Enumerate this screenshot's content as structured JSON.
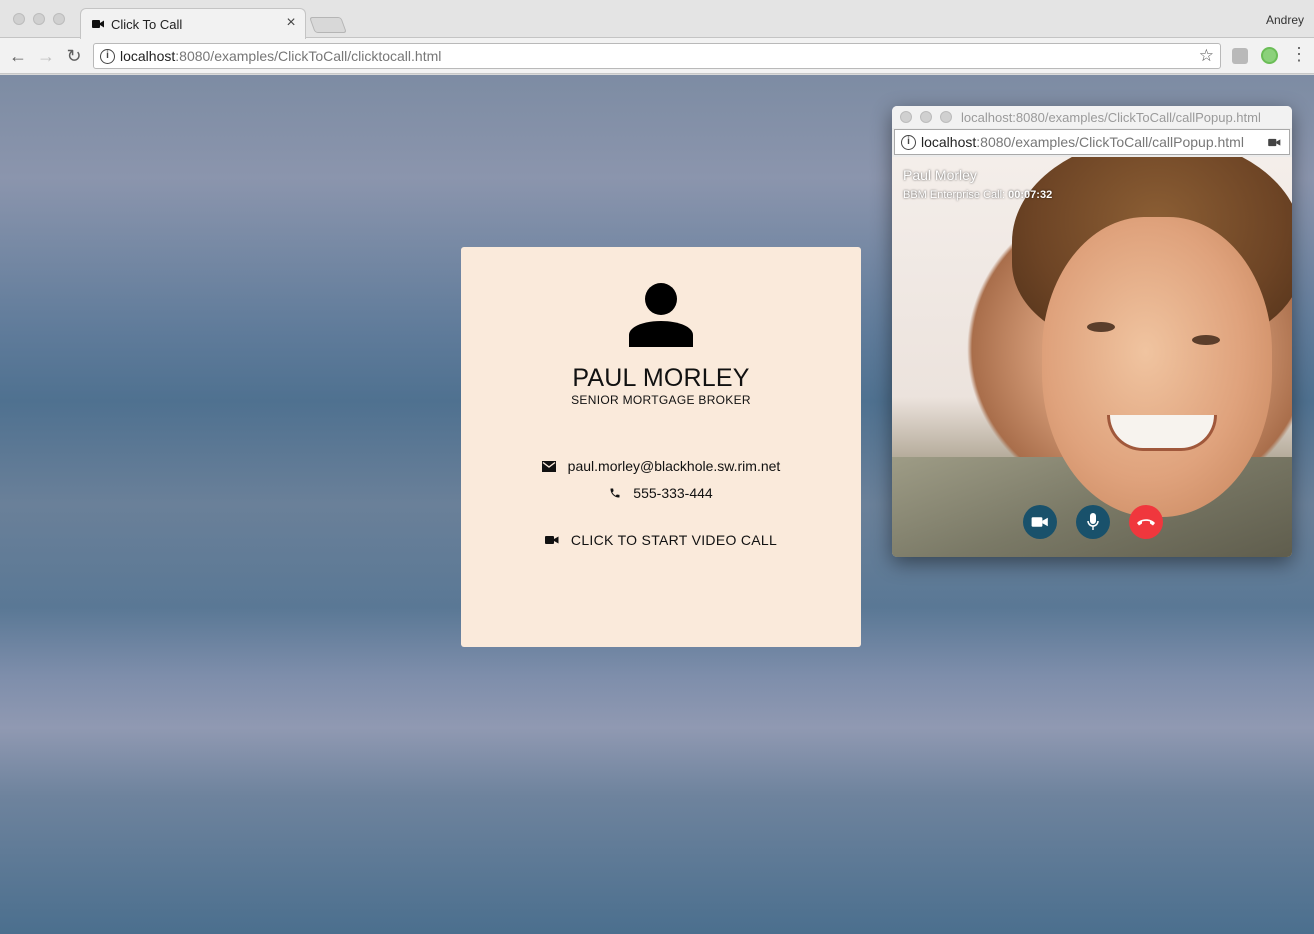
{
  "browser": {
    "tab_title": "Click To Call",
    "profile_name": "Andrey",
    "url_host": "localhost",
    "url_rest": ":8080/examples/ClickToCall/clicktocall.html"
  },
  "card": {
    "name": "PAUL MORLEY",
    "role": "SENIOR MORTGAGE BROKER",
    "email": "paul.morley@blackhole.sw.rim.net",
    "phone": "555-333-444",
    "video_call_label": "CLICK TO START VIDEO CALL",
    "background_color": "#faeadb"
  },
  "popup": {
    "title": "localhost:8080/examples/ClickToCall/callPopup.html",
    "url_host": "localhost",
    "url_rest": ":8080/examples/ClickToCall/callPopup.html",
    "caller_name": "Paul Morley",
    "call_type": "BBM Enterprise Call:",
    "call_duration": "00:07:32",
    "controls": [
      "video-camera-icon",
      "microphone-icon",
      "hang-up-icon"
    ],
    "control_color": "#19516b",
    "hangup_color": "#f0373d"
  }
}
